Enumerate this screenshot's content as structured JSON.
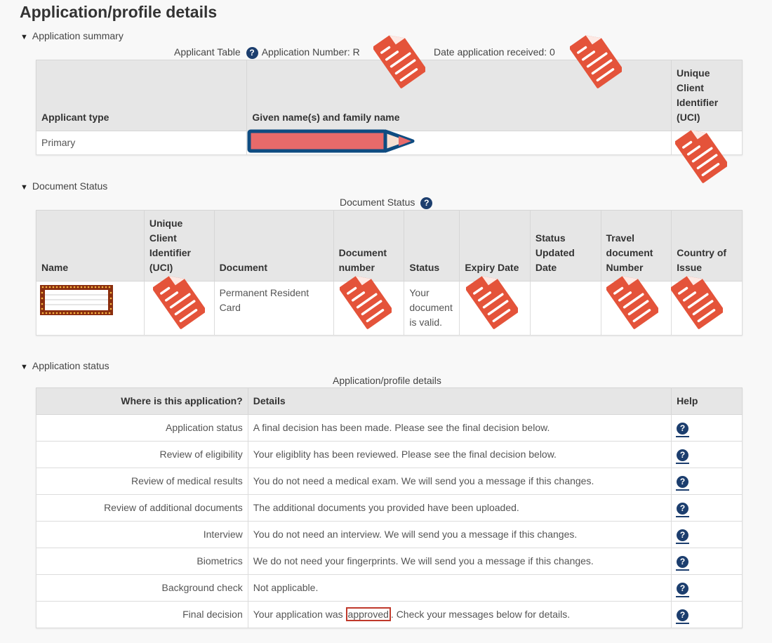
{
  "page": {
    "title": "Application/profile details"
  },
  "application_summary": {
    "toggle_label": "Application summary",
    "caption_table": "Applicant Table",
    "caption_app_number": "Application Number: R",
    "caption_date_received": "Date application received: 0",
    "headers": [
      "Applicant type",
      "Given name(s) and family name",
      "Unique Client Identifier (UCI)"
    ],
    "rows": [
      {
        "applicant_type": "Primary",
        "name": "[redacted]",
        "uci": "[redacted]"
      }
    ]
  },
  "document_status": {
    "toggle_label": "Document Status",
    "caption": "Document Status",
    "headers": [
      "Name",
      "Unique Client Identifier (UCI)",
      "Document",
      "Document number",
      "Status",
      "Expiry Date",
      "Status Updated Date",
      "Travel document Number",
      "Country of Issue"
    ],
    "rows": [
      {
        "name": "[redacted]",
        "uci": "[redacted]",
        "document": "Permanent Resident Card",
        "document_number": "[redacted]",
        "status": "Your document is valid.",
        "expiry_date": "[redacted]",
        "status_updated_date": "",
        "travel_document_number": "[redacted]",
        "country_of_issue": "[redacted]"
      }
    ]
  },
  "application_status": {
    "toggle_label": "Application status",
    "caption": "Application/profile details",
    "headers": [
      "Where is this application?",
      "Details",
      "Help"
    ],
    "rows": [
      {
        "stage": "Application status",
        "details": "A final decision has been made. Please see the final decision below."
      },
      {
        "stage": "Review of eligibility",
        "details": "Your eligiblity has been reviewed. Please see the final decision below."
      },
      {
        "stage": "Review of medical results",
        "details": "You do not need a medical exam. We will send you a message if this changes."
      },
      {
        "stage": "Review of additional documents",
        "details": "The additional documents you provided have been uploaded."
      },
      {
        "stage": "Interview",
        "details": "You do not need an interview. We will send you a message if this changes."
      },
      {
        "stage": "Biometrics",
        "details": "We do not need your fingerprints. We will send you a message if this changes."
      },
      {
        "stage": "Background check",
        "details": "Not applicable."
      },
      {
        "stage": "Final decision",
        "details_before": "Your application was ",
        "details_highlight": "approved",
        "details_after": ". Check your messages below for details."
      }
    ]
  },
  "icons": {
    "help": "?",
    "toggle": "▼"
  },
  "colors": {
    "help_icon": "#1c3e6e",
    "redaction": "#e4533a",
    "highlight_box": "#c0392b",
    "header_bg": "#e6e6e6"
  }
}
